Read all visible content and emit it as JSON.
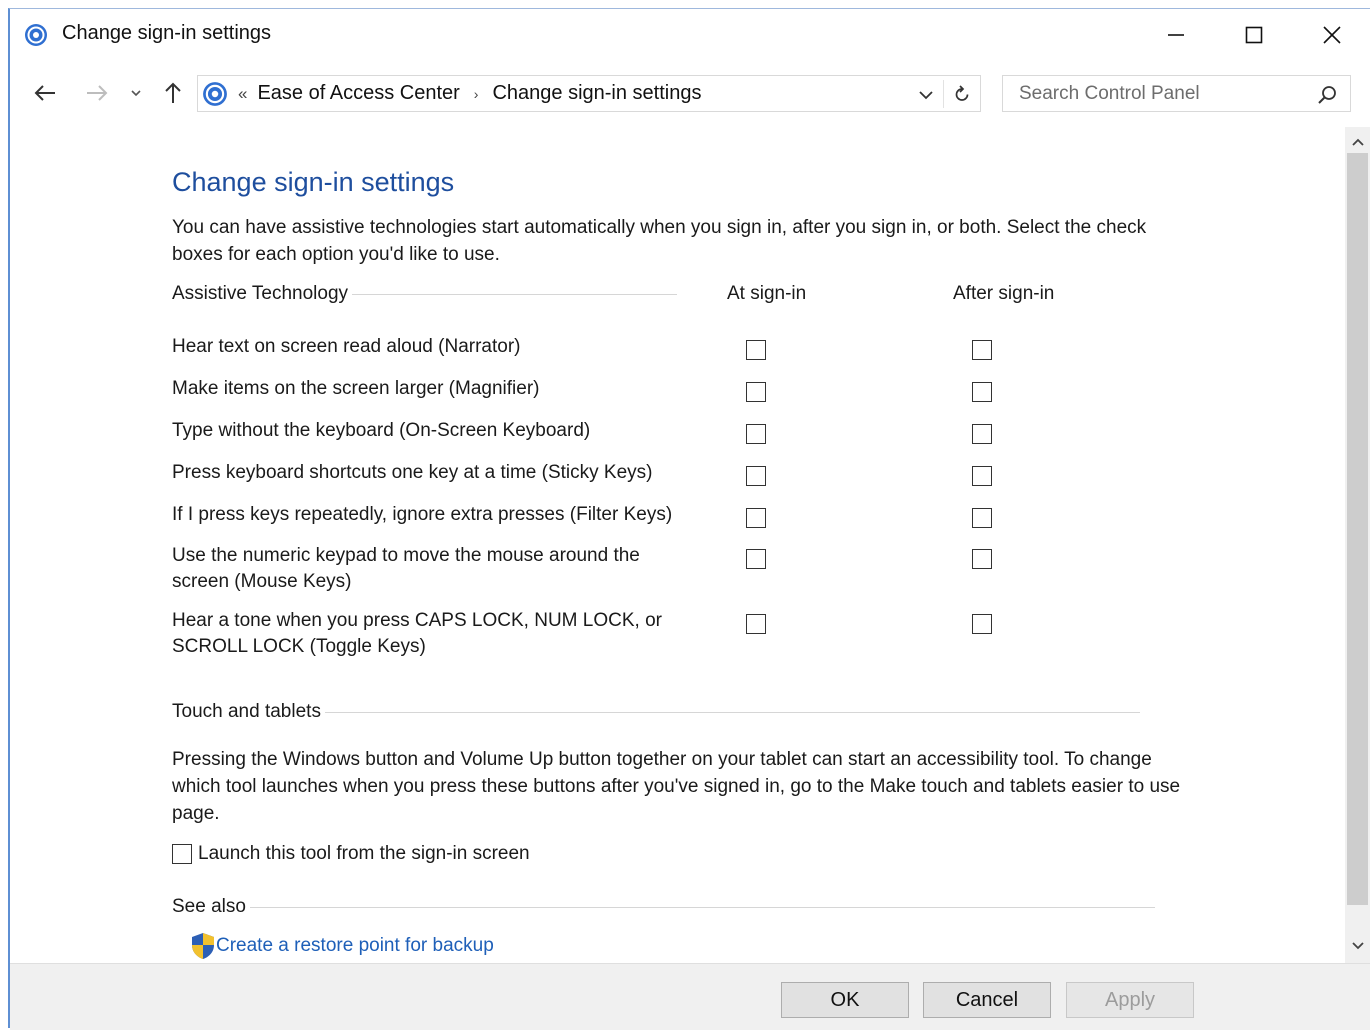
{
  "window": {
    "title": "Change sign-in settings",
    "controls": {
      "minimize_icon": "minimize-icon",
      "maximize_icon": "maximize-icon",
      "close_icon": "close-icon"
    }
  },
  "nav": {
    "overflow": "«",
    "breadcrumb": [
      "Ease of Access Center",
      "Change sign-in settings"
    ],
    "search_placeholder": "Search Control Panel"
  },
  "main": {
    "heading": "Change sign-in settings",
    "intro": "You can have assistive technologies start automatically when you sign in, after you sign in, or both. Select the check boxes for each option you'd like to use.",
    "assistive": {
      "section_label": "Assistive Technology",
      "col_at": "At sign-in",
      "col_after": "After sign-in",
      "rows": [
        {
          "label": "Hear text on screen read aloud (Narrator)",
          "at": false,
          "after": false
        },
        {
          "label": "Make items on the screen larger (Magnifier)",
          "at": false,
          "after": false
        },
        {
          "label": "Type without the keyboard (On-Screen Keyboard)",
          "at": false,
          "after": false
        },
        {
          "label": "Press keyboard shortcuts one key at a time (Sticky Keys)",
          "at": false,
          "after": false
        },
        {
          "label": "If I press keys repeatedly, ignore extra presses (Filter Keys)",
          "at": false,
          "after": false
        },
        {
          "label": "Use the numeric keypad to move the mouse around the screen (Mouse Keys)",
          "at": false,
          "after": false
        },
        {
          "label": "Hear a tone when you press CAPS LOCK, NUM LOCK, or SCROLL LOCK (Toggle Keys)",
          "at": false,
          "after": false
        }
      ]
    },
    "touch": {
      "section_label": "Touch and tablets",
      "text": "Pressing the Windows button and Volume Up button together on your tablet can start an accessibility tool. To change which tool launches when you press these buttons after you've signed in, go to the Make touch and tablets easier to use page.",
      "launch_label": "Launch this tool from the sign-in screen",
      "launch_checked": false
    },
    "see_also": {
      "section_label": "See also",
      "link": "Create a restore point for backup"
    }
  },
  "footer": {
    "ok": "OK",
    "cancel": "Cancel",
    "apply": "Apply"
  },
  "colors": {
    "heading": "#1e4e9e",
    "link": "#1e5fb8",
    "footer_bg": "#f0f0f0"
  }
}
